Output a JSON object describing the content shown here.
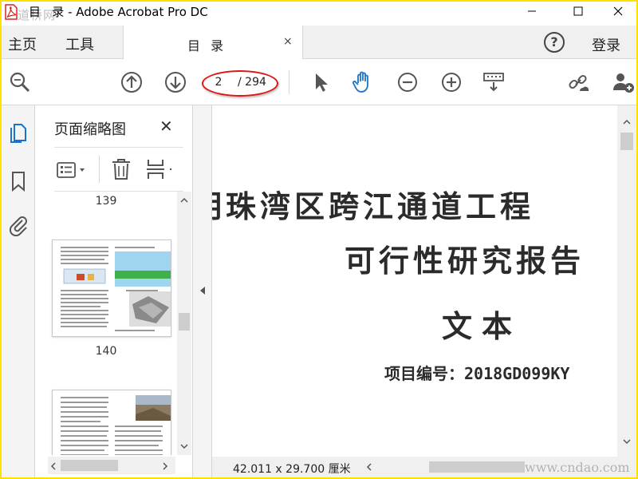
{
  "title_bar": {
    "title": "目   录 - Adobe Acrobat Pro DC",
    "watermark": "道桥网"
  },
  "menu": {
    "home": "主页",
    "tools": "工具",
    "document_tab": "目  录",
    "tab_close": "×",
    "help": "?",
    "login": "登录"
  },
  "toolbar": {
    "current_page": "2",
    "total_pages": "/ 294"
  },
  "thumbnails_panel": {
    "title": "页面缩略图",
    "close": "✕",
    "pages": [
      {
        "label": "139"
      },
      {
        "label": "140"
      }
    ]
  },
  "document": {
    "line1": "明珠湾区跨江通道工程",
    "line2": "可行性研究报告",
    "line3": "文本",
    "line4": "项目编号：2018GD099KY"
  },
  "statusbar": {
    "dimensions": "42.011 x 29.700 厘米",
    "watermark": "www.cndao.com"
  },
  "colors": {
    "frame": "#ffe100",
    "accent": "#1a73c9",
    "highlight_ring": "#e01515"
  },
  "icons": [
    "acrobat-logo-icon",
    "minimize-icon",
    "maximize-icon",
    "close-icon",
    "zoom-search-icon",
    "page-up-icon",
    "page-down-icon",
    "select-arrow-icon",
    "hand-tool-icon",
    "zoom-out-icon",
    "zoom-in-icon",
    "keyboard-selector-icon",
    "share-link-icon",
    "add-user-icon",
    "page-thumbnails-icon",
    "bookmark-icon",
    "attachment-icon",
    "options-menu-icon",
    "trash-icon",
    "insert-page-icon"
  ]
}
